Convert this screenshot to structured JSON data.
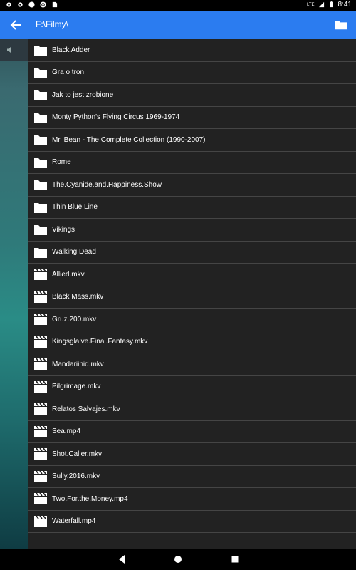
{
  "status_bar": {
    "time": "8:41",
    "network": "LTE"
  },
  "app_bar": {
    "path": "F:\\Filmy\\"
  },
  "items": [
    {
      "type": "folder",
      "label": "Black Adder"
    },
    {
      "type": "folder",
      "label": "Gra o tron"
    },
    {
      "type": "folder",
      "label": "Jak to jest zrobione"
    },
    {
      "type": "folder",
      "label": "Monty Python's Flying Circus 1969-1974"
    },
    {
      "type": "folder",
      "label": "Mr. Bean - The Complete Collection (1990-2007)"
    },
    {
      "type": "folder",
      "label": "Rome"
    },
    {
      "type": "folder",
      "label": "The.Cyanide.and.Happiness.Show"
    },
    {
      "type": "folder",
      "label": "Thin Blue Line"
    },
    {
      "type": "folder",
      "label": "Vikings"
    },
    {
      "type": "folder",
      "label": "Walking Dead"
    },
    {
      "type": "video",
      "label": "Allied.mkv"
    },
    {
      "type": "video",
      "label": "Black Mass.mkv"
    },
    {
      "type": "video",
      "label": "Gruz.200.mkv"
    },
    {
      "type": "video",
      "label": "Kingsglaive.Final.Fantasy.mkv"
    },
    {
      "type": "video",
      "label": "Mandariinid.mkv"
    },
    {
      "type": "video",
      "label": "Pilgrimage.mkv"
    },
    {
      "type": "video",
      "label": "Relatos Salvajes.mkv"
    },
    {
      "type": "video",
      "label": "Sea.mp4"
    },
    {
      "type": "video",
      "label": "Shot.Caller.mkv"
    },
    {
      "type": "video",
      "label": "Sully.2016.mkv"
    },
    {
      "type": "video",
      "label": "Two.For.the.Money.mp4"
    },
    {
      "type": "video",
      "label": "Waterfall.mp4"
    }
  ],
  "colors": {
    "app_bar": "#2b7cf0",
    "list_bg": "#222222",
    "divider": "#454545"
  }
}
